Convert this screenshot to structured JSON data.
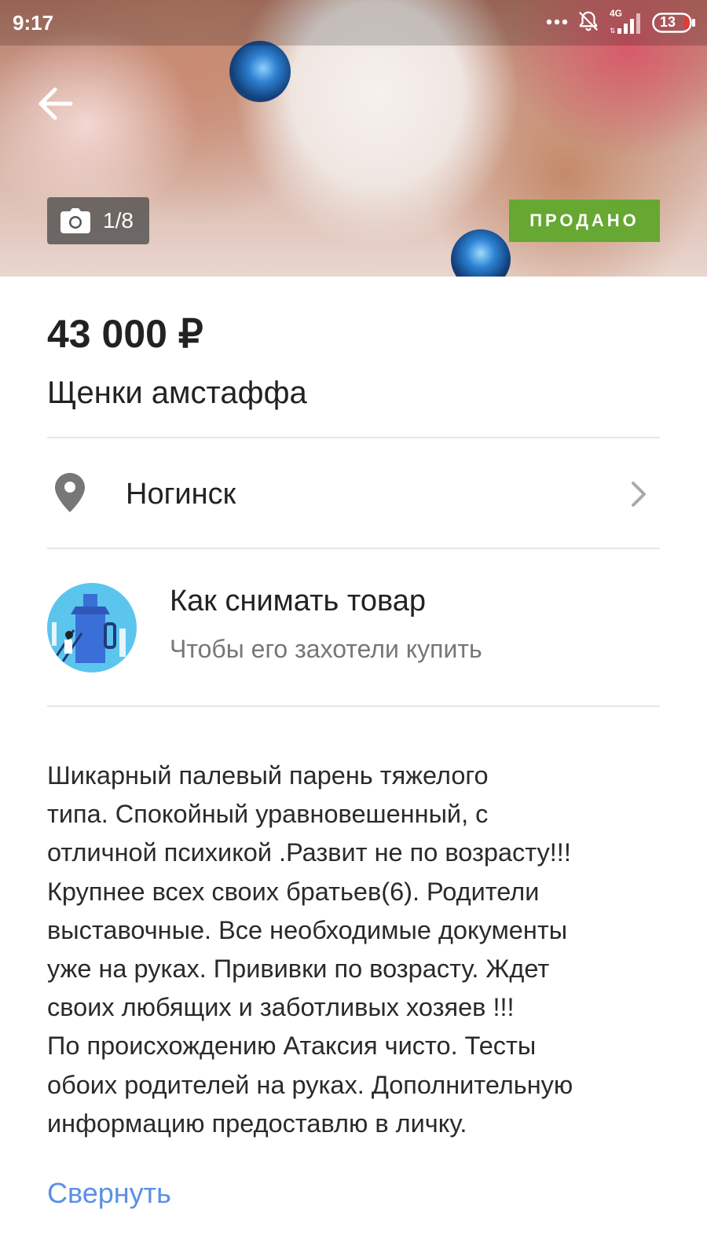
{
  "status_bar": {
    "time": "9:17",
    "network": "4G",
    "battery": "13",
    "icons": [
      "more-dots-icon",
      "bell-off-icon",
      "signal-icon",
      "battery-icon"
    ]
  },
  "gallery": {
    "counter": "1/8",
    "badge": "ПРОДАНО",
    "badge_color": "#66a832"
  },
  "listing": {
    "price": "43 000 ₽",
    "title": "Щенки амстаффа",
    "location": "Ногинск"
  },
  "promo": {
    "title": "Как снимать товар",
    "subtitle": "Чтобы его захотели купить"
  },
  "description": {
    "text": "Шикарный палевый парень тяжелого\nтипа. Спокойный уравновешенный, с\nотличной психикой .Развит не по возрасту!!!\nКрупнее всех своих братьев(6). Родители\nвыставочные. Все необходимые документы\nуже на руках. Прививки по возрасту. Ждет\nсвоих любящих и заботливых хозяев !!!\nПо происхождению Атаксия чисто. Тесты\nобоих родителей на руках. Дополнительную\nинформацию предоставлю в личку.",
    "collapse_label": "Свернуть",
    "link_color": "#5b8fe6"
  }
}
